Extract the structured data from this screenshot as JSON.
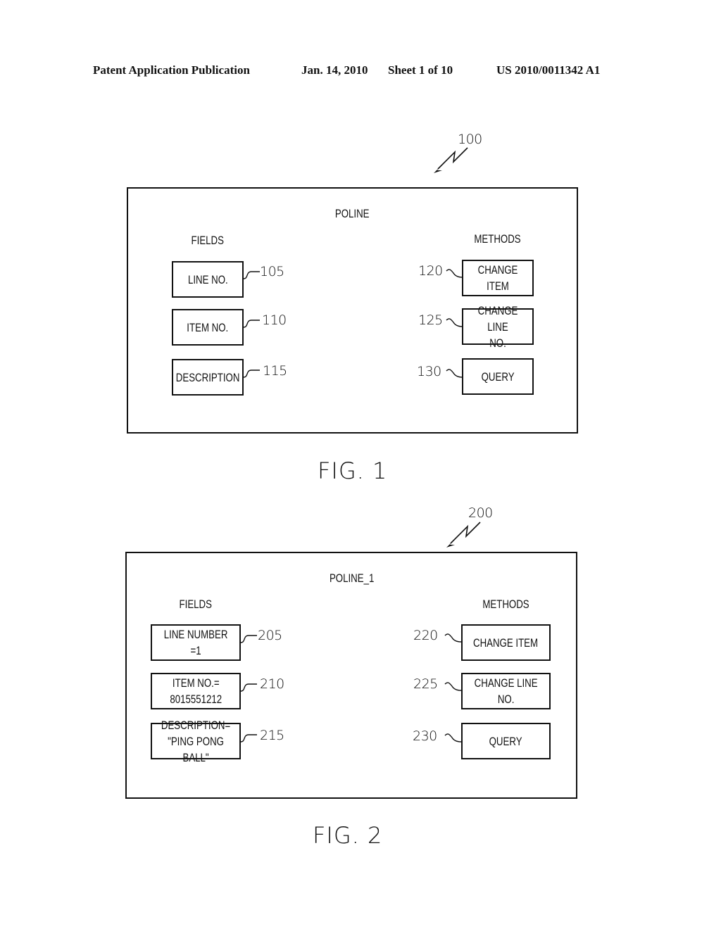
{
  "header": {
    "publication": "Patent Application Publication",
    "date": "Jan. 14, 2010",
    "sheet": "Sheet 1 of 10",
    "number": "US 2010/0011342 A1"
  },
  "figures": [
    {
      "ref": "100",
      "title": "POLINE",
      "fields_heading": "FIELDS",
      "methods_heading": "METHODS",
      "fields": [
        {
          "label": "LINE NO.",
          "ref": "105"
        },
        {
          "label": "ITEM NO.",
          "ref": "110"
        },
        {
          "label": "DESCRIPTION",
          "ref": "115"
        }
      ],
      "methods": [
        {
          "label": "CHANGE ITEM",
          "ref": "120"
        },
        {
          "label": "CHANGE LINE\nNO.",
          "ref": "125"
        },
        {
          "label": "QUERY",
          "ref": "130"
        }
      ],
      "caption": "FIG. 1"
    },
    {
      "ref": "200",
      "title": "POLINE_1",
      "fields_heading": "FIELDS",
      "methods_heading": "METHODS",
      "fields": [
        {
          "label": "LINE NUMBER\n=1",
          "ref": "205"
        },
        {
          "label": "ITEM NO.=\n8015551212",
          "ref": "210"
        },
        {
          "label": "DESCRIPTION=\n\"PING PONG BALL\"",
          "ref": "215"
        }
      ],
      "methods": [
        {
          "label": "CHANGE ITEM",
          "ref": "220"
        },
        {
          "label": "CHANGE LINE\nNO.",
          "ref": "225"
        },
        {
          "label": "QUERY",
          "ref": "230"
        }
      ],
      "caption": "FIG. 2"
    }
  ]
}
